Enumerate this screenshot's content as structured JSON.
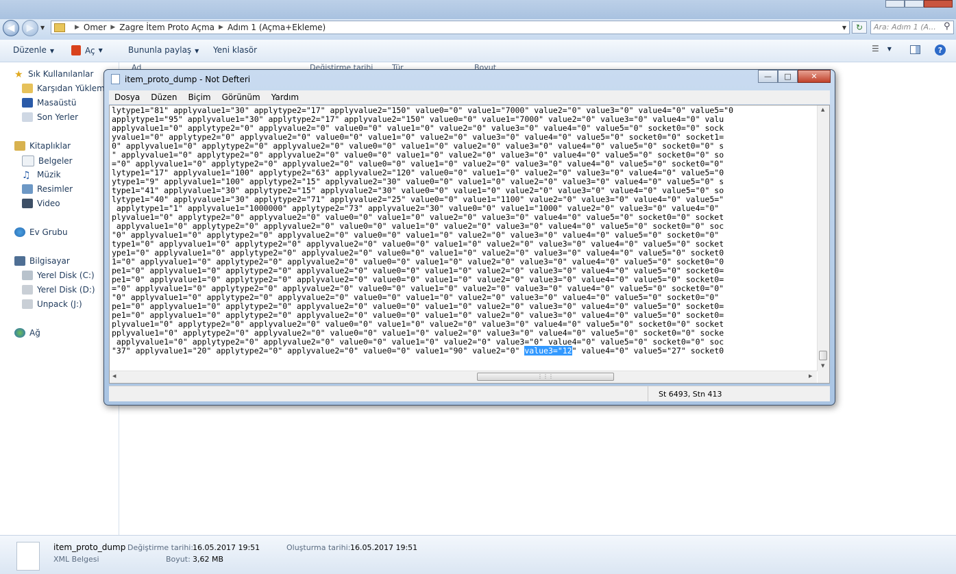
{
  "explorer": {
    "breadcrumb": [
      "Omer",
      "Zagre İtem Proto Açma",
      "Adım 1 (Açma+Ekleme)"
    ],
    "search_placeholder": "Ara: Adım 1 (A...",
    "toolbar": {
      "organize": "Düzenle",
      "open": "Aç",
      "share": "Bununla paylaş",
      "new_folder": "Yeni klasör"
    },
    "columns": [
      "Ad",
      "Değiştirme tarihi",
      "Tür",
      "Boyut"
    ],
    "nav": {
      "favorites": "Sık Kullanılanlar",
      "downloads": "Karşıdan Yüklemeler",
      "desktop": "Masaüstü",
      "recent": "Son Yerler",
      "libraries": "Kitaplıklar",
      "documents": "Belgeler",
      "music": "Müzik",
      "pictures": "Resimler",
      "video": "Video",
      "homegroup": "Ev Grubu",
      "computer": "Bilgisayar",
      "disk_c": "Yerel Disk (C:)",
      "disk_d": "Yerel Disk (D:)",
      "unpack": "Unpack (J:)",
      "network": "Ağ"
    },
    "details": {
      "filename": "item_proto_dump",
      "filetype": "XML Belgesi",
      "modified_label": "Değiştirme tarihi:",
      "modified_value": "16.05.2017 19:51",
      "size_label": "Boyut:",
      "size_value": "3,62 MB",
      "created_label": "Oluşturma tarihi:",
      "created_value": "16.05.2017 19:51"
    }
  },
  "notepad": {
    "title": "item_proto_dump - Not Defteri",
    "menu": [
      "Dosya",
      "Düzen",
      "Biçim",
      "Görünüm",
      "Yardım"
    ],
    "lines": [
      "lytype1=\"81\" applyvalue1=\"30\" applytype2=\"17\" applyvalue2=\"150\" value0=\"0\" value1=\"7000\" value2=\"0\" value3=\"0\" value4=\"0\" value5=\"0",
      "applytype1=\"95\" applyvalue1=\"30\" applytype2=\"17\" applyvalue2=\"150\" value0=\"0\" value1=\"7000\" value2=\"0\" value3=\"0\" value4=\"0\" valu",
      "applyvalue1=\"0\" applytype2=\"0\" applyvalue2=\"0\" value0=\"0\" value1=\"0\" value2=\"0\" value3=\"0\" value4=\"0\" value5=\"0\" socket0=\"0\" sock",
      "yvalue1=\"0\" applytype2=\"0\" applyvalue2=\"0\" value0=\"0\" value1=\"0\" value2=\"0\" value3=\"0\" value4=\"0\" value5=\"0\" socket0=\"0\" socket1=",
      "0\" applyvalue1=\"0\" applytype2=\"0\" applyvalue2=\"0\" value0=\"0\" value1=\"0\" value2=\"0\" value3=\"0\" value4=\"0\" value5=\"0\" socket0=\"0\" s",
      "\" applyvalue1=\"0\" applytype2=\"0\" applyvalue2=\"0\" value0=\"0\" value1=\"0\" value2=\"0\" value3=\"0\" value4=\"0\" value5=\"0\" socket0=\"0\" so",
      "=\"0\" applyvalue1=\"0\" applytype2=\"0\" applyvalue2=\"0\" value0=\"0\" value1=\"0\" value2=\"0\" value3=\"0\" value4=\"0\" value5=\"0\" socket0=\"0\"",
      "lytype1=\"17\" applyvalue1=\"100\" applytype2=\"63\" applyvalue2=\"120\" value0=\"0\" value1=\"0\" value2=\"0\" value3=\"0\" value4=\"0\" value5=\"0",
      "ytype1=\"9\" applyvalue1=\"100\" applytype2=\"15\" applyvalue2=\"30\" value0=\"0\" value1=\"0\" value2=\"0\" value3=\"0\" value4=\"0\" value5=\"0\" s",
      "type1=\"41\" applyvalue1=\"30\" applytype2=\"15\" applyvalue2=\"30\" value0=\"0\" value1=\"0\" value2=\"0\" value3=\"0\" value4=\"0\" value5=\"0\" so",
      "lytype1=\"40\" applyvalue1=\"30\" applytype2=\"71\" applyvalue2=\"25\" value0=\"0\" value1=\"1100\" value2=\"0\" value3=\"0\" value4=\"0\" value5=\"",
      " applytype1=\"1\" applyvalue1=\"1000000\" applytype2=\"73\" applyvalue2=\"30\" value0=\"0\" value1=\"1000\" value2=\"0\" value3=\"0\" value4=\"0\"",
      "plyvalue1=\"0\" applytype2=\"0\" applyvalue2=\"0\" value0=\"0\" value1=\"0\" value2=\"0\" value3=\"0\" value4=\"0\" value5=\"0\" socket0=\"0\" socket",
      " applyvalue1=\"0\" applytype2=\"0\" applyvalue2=\"0\" value0=\"0\" value1=\"0\" value2=\"0\" value3=\"0\" value4=\"0\" value5=\"0\" socket0=\"0\" soc",
      "\"0\" applyvalue1=\"0\" applytype2=\"0\" applyvalue2=\"0\" value0=\"0\" value1=\"0\" value2=\"0\" value3=\"0\" value4=\"0\" value5=\"0\" socket0=\"0\"",
      "type1=\"0\" applyvalue1=\"0\" applytype2=\"0\" applyvalue2=\"0\" value0=\"0\" value1=\"0\" value2=\"0\" value3=\"0\" value4=\"0\" value5=\"0\" socket",
      "ype1=\"0\" applyvalue1=\"0\" applytype2=\"0\" applyvalue2=\"0\" value0=\"0\" value1=\"0\" value2=\"0\" value3=\"0\" value4=\"0\" value5=\"0\" socket0",
      "1=\"0\" applyvalue1=\"0\" applytype2=\"0\" applyvalue2=\"0\" value0=\"0\" value1=\"0\" value2=\"0\" value3=\"0\" value4=\"0\" value5=\"0\" socket0=\"0",
      "pe1=\"0\" applyvalue1=\"0\" applytype2=\"0\" applyvalue2=\"0\" value0=\"0\" value1=\"0\" value2=\"0\" value3=\"0\" value4=\"0\" value5=\"0\" socket0=",
      "pe1=\"0\" applyvalue1=\"0\" applytype2=\"0\" applyvalue2=\"0\" value0=\"0\" value1=\"0\" value2=\"0\" value3=\"0\" value4=\"0\" value5=\"0\" socket0=",
      "=\"0\" applyvalue1=\"0\" applytype2=\"0\" applyvalue2=\"0\" value0=\"0\" value1=\"0\" value2=\"0\" value3=\"0\" value4=\"0\" value5=\"0\" socket0=\"0\"",
      "\"0\" applyvalue1=\"0\" applytype2=\"0\" applyvalue2=\"0\" value0=\"0\" value1=\"0\" value2=\"0\" value3=\"0\" value4=\"0\" value5=\"0\" socket0=\"0\"",
      "pe1=\"0\" applyvalue1=\"0\" applytype2=\"0\" applyvalue2=\"0\" value0=\"0\" value1=\"0\" value2=\"0\" value3=\"0\" value4=\"0\" value5=\"0\" socket0=",
      "pe1=\"0\" applyvalue1=\"0\" applytype2=\"0\" applyvalue2=\"0\" value0=\"0\" value1=\"0\" value2=\"0\" value3=\"0\" value4=\"0\" value5=\"0\" socket0=",
      "plyvalue1=\"0\" applytype2=\"0\" applyvalue2=\"0\" value0=\"0\" value1=\"0\" value2=\"0\" value3=\"0\" value4=\"0\" value5=\"0\" socket0=\"0\" socket",
      "pplyvalue1=\"0\" applytype2=\"0\" applyvalue2=\"0\" value0=\"0\" value1=\"0\" value2=\"0\" value3=\"0\" value4=\"0\" value5=\"0\" socket0=\"0\" socke",
      " applyvalue1=\"0\" applytype2=\"0\" applyvalue2=\"0\" value0=\"0\" value1=\"0\" value2=\"0\" value3=\"0\" value4=\"0\" value5=\"0\" socket0=\"0\" soc"
    ],
    "last_line_before": "\"37\" applyvalue1=\"20\" applytype2=\"0\" applyvalue2=\"0\" value0=\"0\" value1=\"90\" value2=\"0\" ",
    "last_line_selected": "value3=\"12",
    "last_line_after": "\" value4=\"0\" value5=\"27\" socket0",
    "status": "St 6493, Stn 413"
  },
  "colors": {
    "selection": "#3399ff",
    "explorer_text": "#1e395b"
  }
}
